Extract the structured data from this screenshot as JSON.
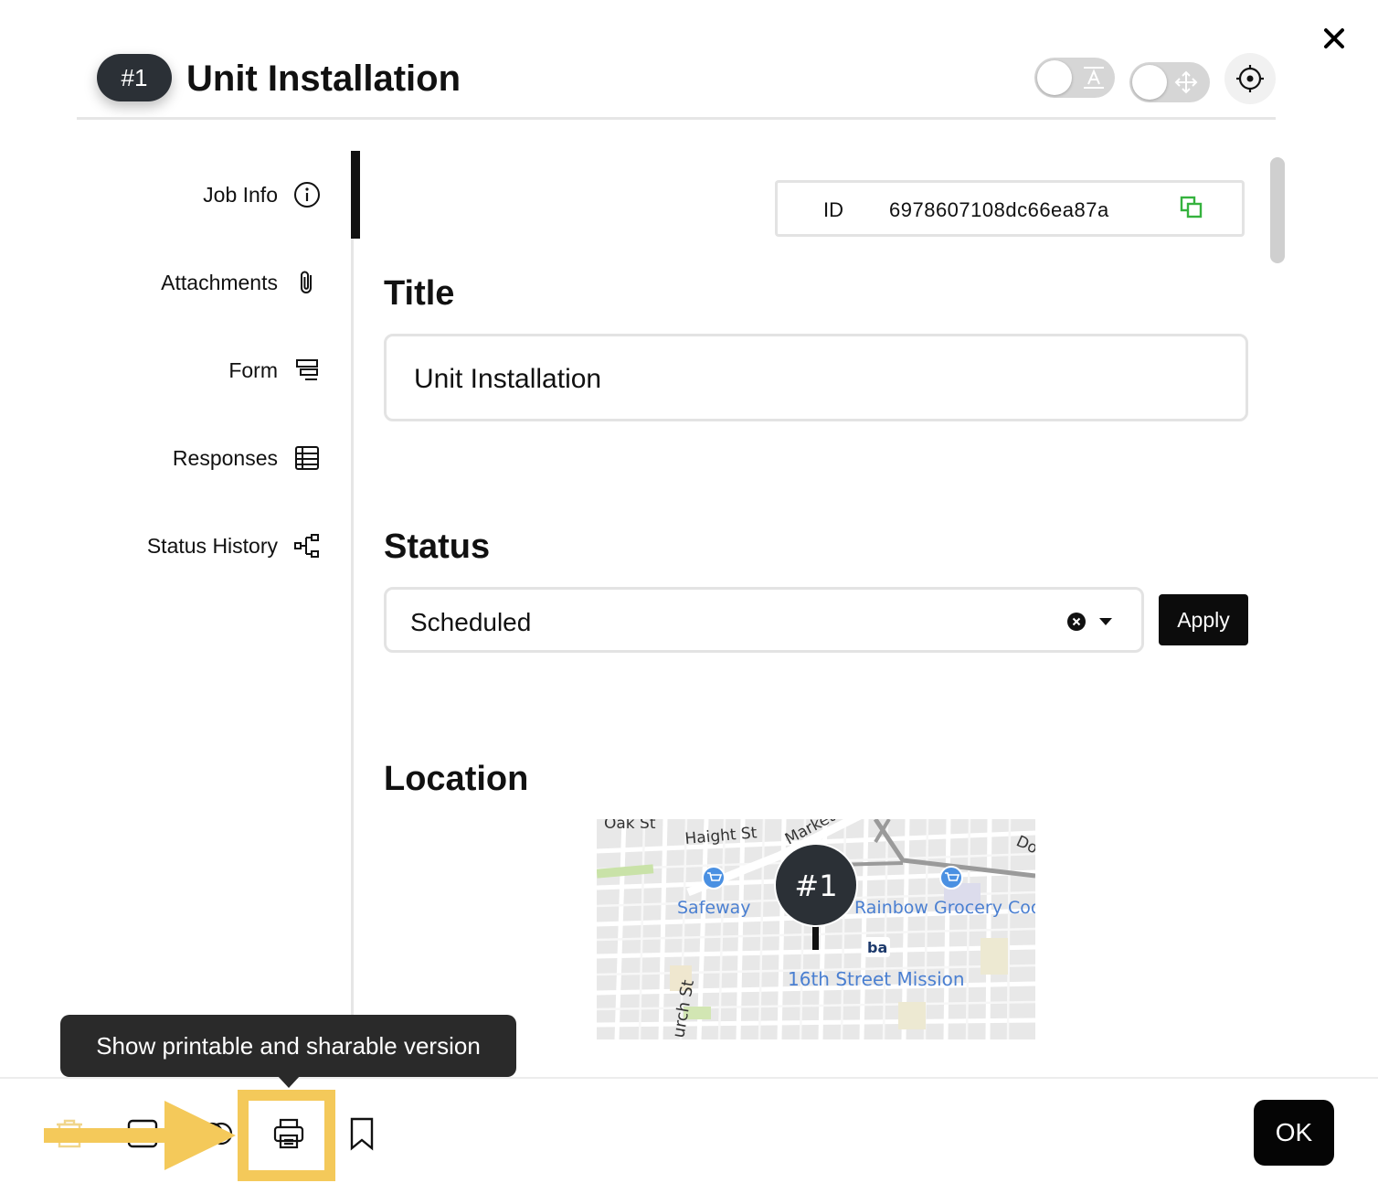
{
  "header": {
    "badge": "#1",
    "title": "Unit Installation",
    "close_icon": "close-icon",
    "toggles": [
      {
        "name": "text-toggle",
        "icon": "text-icon",
        "on": false
      },
      {
        "name": "move-toggle",
        "icon": "move-icon",
        "on": false
      }
    ],
    "locate_icon": "crosshair-icon"
  },
  "sidebar": {
    "items": [
      {
        "label": "Job Info",
        "icon": "info-icon",
        "active": true
      },
      {
        "label": "Attachments",
        "icon": "paperclip-icon"
      },
      {
        "label": "Form",
        "icon": "form-icon"
      },
      {
        "label": "Responses",
        "icon": "table-icon"
      },
      {
        "label": "Status History",
        "icon": "hierarchy-icon"
      }
    ]
  },
  "job": {
    "id_label": "ID",
    "id_value": "6978607108dc66ea87a",
    "title_heading": "Title",
    "title_value": "Unit Installation",
    "status_heading": "Status",
    "status_value": "Scheduled",
    "apply_label": "Apply",
    "location_heading": "Location"
  },
  "map": {
    "labels": {
      "oak": "Oak St",
      "haight": "Haight St",
      "market": "Market St",
      "do": "Do",
      "safeway": "Safeway",
      "rainbow": "Rainbow Grocery Coo",
      "mission": "16th Street Mission",
      "church": "urch St",
      "bart": "ba"
    },
    "pin": "#1"
  },
  "footer": {
    "tooltip": "Show printable and sharable version",
    "tools": [
      "trash-icon",
      "window-icon",
      "circles-icon",
      "printer-icon",
      "bookmark-icon"
    ],
    "ok_label": "OK",
    "highlight_color": "#f4c95a"
  }
}
